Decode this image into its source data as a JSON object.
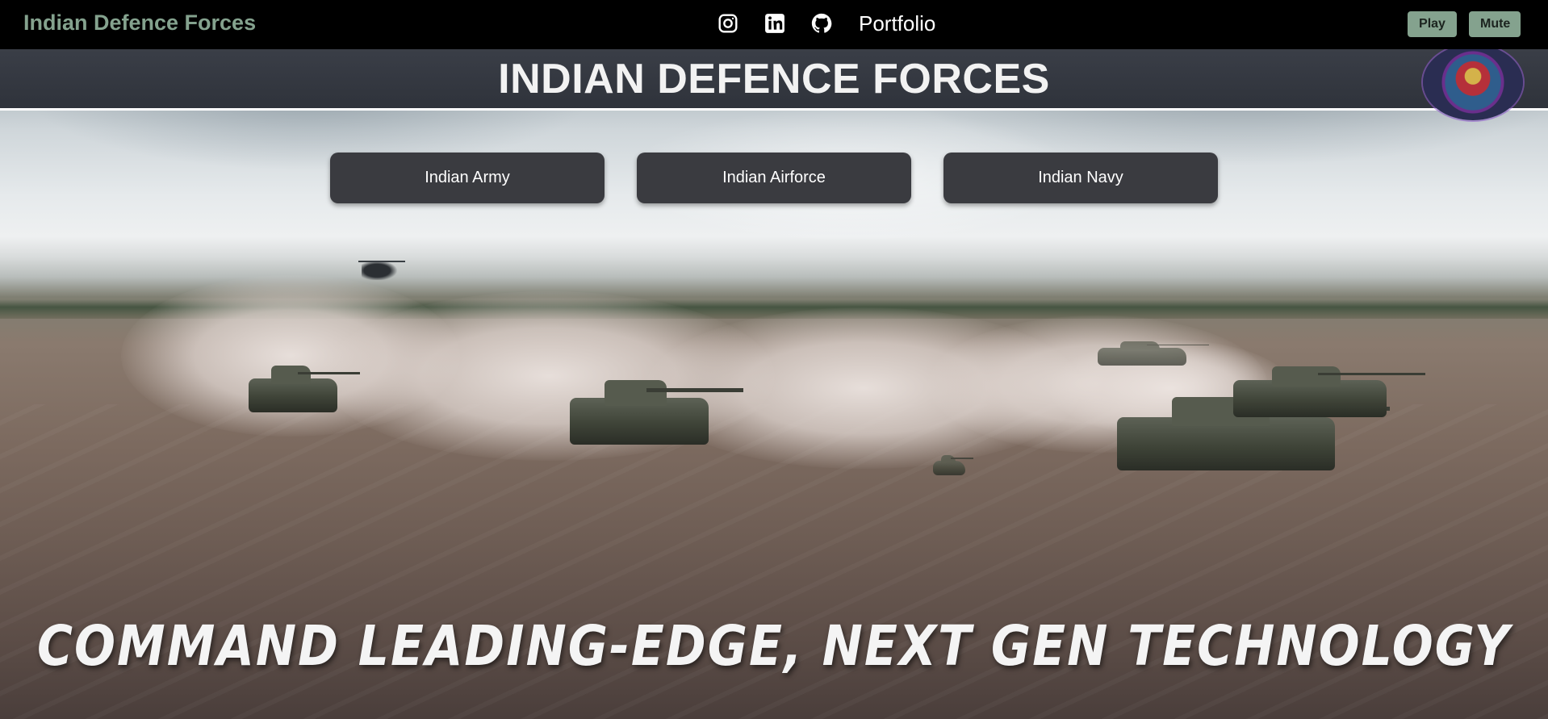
{
  "navbar": {
    "brand": "Indian Defence Forces",
    "social_icons": [
      "instagram-icon",
      "linkedin-icon",
      "github-icon"
    ],
    "portfolio_label": "Portfolio",
    "play_label": "Play",
    "mute_label": "Mute"
  },
  "hero": {
    "title": "INDIAN DEFENCE FORCES",
    "buttons": [
      "Indian Army",
      "Indian Airforce",
      "Indian Navy"
    ],
    "video_caption": "COMMAND LEADING-EDGE, NEXT GEN TECHNOLOGY"
  },
  "colors": {
    "brand_green": "#84a28e",
    "navbar_bg": "#000000",
    "title_bar_bg": "#2f333b",
    "force_button_bg": "#3a3b40"
  }
}
